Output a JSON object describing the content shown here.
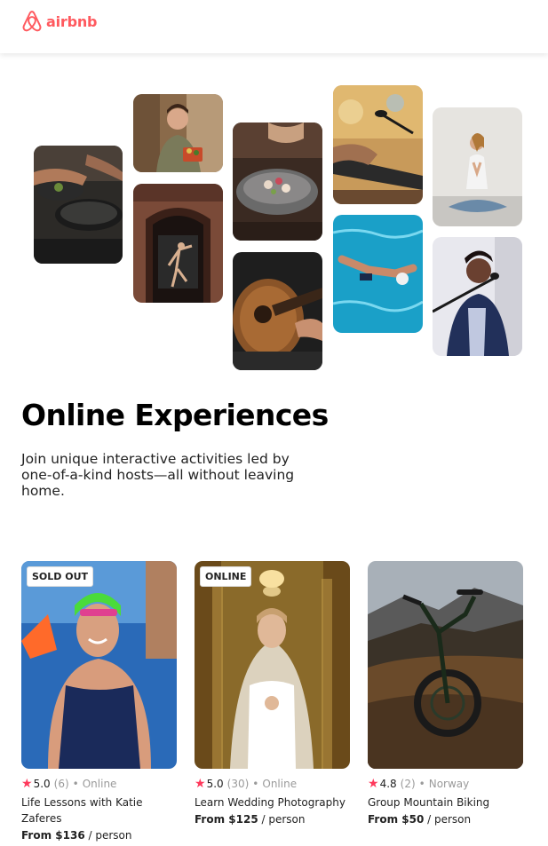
{
  "brand": {
    "name": "airbnb",
    "color": "#FF5A5F"
  },
  "hero": {
    "title": "Online Experiences",
    "subtitle": "Join unique interactive activities led by one-of-a-kind hosts—all without leaving home.",
    "collage_images": [
      "cooking-pans-photo",
      "woman-with-produce-photo",
      "dancer-in-doorway-photo",
      "food-bowl-photo",
      "guitar-player-photo",
      "musician-microphone-photo",
      "swimmer-pool-photo",
      "yoga-woman-photo",
      "singer-microphone-photo"
    ]
  },
  "cards": [
    {
      "badge": "SOLD OUT",
      "rating": "5.0",
      "reviews": "(6)",
      "separator": "•",
      "location": "Online",
      "title": "Life Lessons with Katie Zaferes",
      "price_from": "From $136",
      "price_unit": " / person",
      "image": "athlete-portrait-photo"
    },
    {
      "badge": "ONLINE",
      "rating": "5.0",
      "reviews": "(30)",
      "separator": "•",
      "location": "Online",
      "title": "Learn Wedding Photography",
      "price_from": "From $125",
      "price_unit": " / person",
      "image": "bride-portrait-photo"
    },
    {
      "badge": "",
      "rating": "4.8",
      "reviews": "(2)",
      "separator": "•",
      "location": "Norway",
      "title": "Group Mountain Biking",
      "price_from": "From $50",
      "price_unit": " / person",
      "image": "mountain-bike-photo"
    }
  ],
  "colors": {
    "star": "#FE395C",
    "muted_text": "#9a9a9a"
  }
}
